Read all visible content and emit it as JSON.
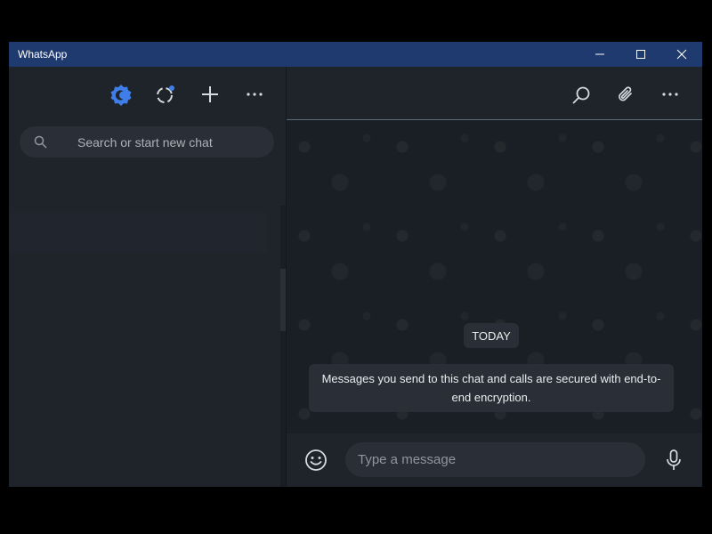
{
  "window": {
    "title": "WhatsApp"
  },
  "window_controls": {
    "minimize": "—",
    "maximize": "☐",
    "close": "✕"
  },
  "sidebar": {
    "search": {
      "placeholder": "Search or start new chat"
    }
  },
  "chat": {
    "date_separator": "TODAY",
    "system_message": "Messages you send to this chat and calls are secured with end-to-end encryption."
  },
  "composer": {
    "placeholder": "Type a message"
  },
  "colors": {
    "titlebar": "#1f3a6e",
    "accent": "#3f7ee8",
    "panel": "#1f232a",
    "bubble": "#2a2f37"
  }
}
